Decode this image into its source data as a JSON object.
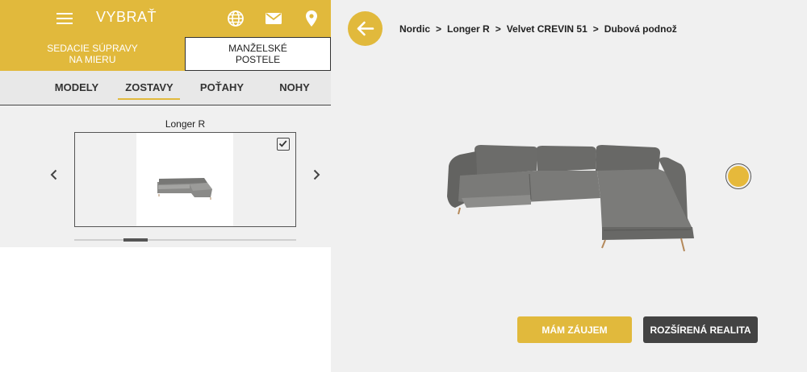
{
  "colors": {
    "accent": "#e1b93c",
    "dark_button": "#434343",
    "swatch": "#e6b93b",
    "sofa": "#6f6f6d"
  },
  "header": {
    "title": "VYBRAŤ",
    "menu_icon": "hamburger-menu-icon",
    "icons": [
      "globe-icon",
      "mail-icon",
      "location-pin-icon"
    ]
  },
  "categories": [
    {
      "label": "SEDACIE SÚPRAVY\nNA MIERU",
      "active": true
    },
    {
      "label": "MANŽELSKÉ\nPOSTELE",
      "active": false
    }
  ],
  "tabs": [
    {
      "label": "MODELY",
      "active": false
    },
    {
      "label": "ZOSTAVY",
      "active": true
    },
    {
      "label": "POŤAHY",
      "active": false
    },
    {
      "label": "NOHY",
      "active": false
    }
  ],
  "carousel": {
    "label": "Longer R",
    "selected": true,
    "prev_icon": "chevron-left-icon",
    "next_icon": "chevron-right-icon"
  },
  "breadcrumb": [
    "Nordic",
    "Longer R",
    "Velvet CREVIN 51",
    "Dubová podnož"
  ],
  "breadcrumb_separator": ">",
  "back_icon": "arrow-left-icon",
  "actions": {
    "interest": "MÁM ZÁUJEM",
    "ar": "ROZŠÍRENÁ REALITA"
  }
}
